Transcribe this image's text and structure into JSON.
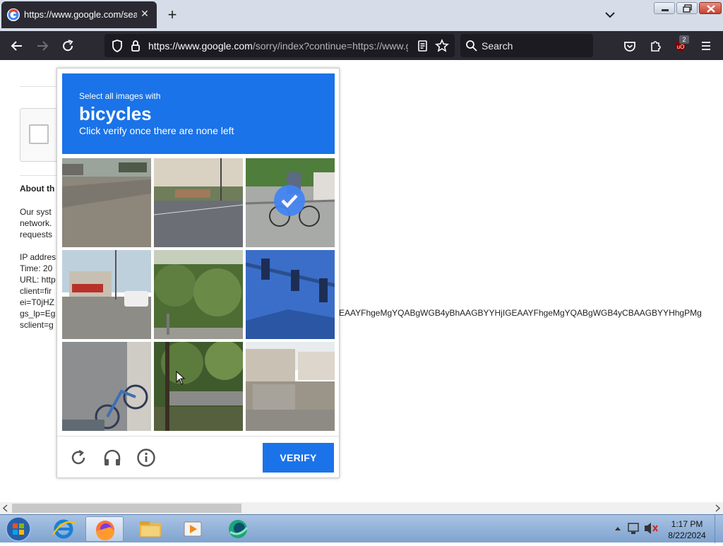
{
  "browser": {
    "tab_title": "https://www.google.com/search",
    "url_host": "https://www.google.com",
    "url_rest": "/sorry/index?continue=https://www.google.com/search",
    "search_placeholder": "Search",
    "extension_badge": "2"
  },
  "page": {
    "about_heading": "About th",
    "lines": [
      "Our syst",
      "network.",
      "requests",
      "",
      "IP addres",
      "Time: 20",
      "URL: http",
      "client=fir",
      "ei=T0jHZ",
      "gs_lp=Eg",
      "sclient=g"
    ],
    "gs_lp_tail": "EAAYFhgeMgYQABgWGB4yBhAAGBYYHjIGEAAYFhgeMgYQABgWGB4yCBAAGBYYHhgPMg"
  },
  "captcha": {
    "instruction_top": "Select all images with",
    "target": "bicycles",
    "instruction_bottom": "Click verify once there are none left",
    "verify_label": "VERIFY",
    "tiles_selected": [
      false,
      false,
      true,
      false,
      false,
      false,
      false,
      false,
      false
    ]
  },
  "taskbar": {
    "time": "1:17 PM",
    "date": "8/22/2024"
  }
}
